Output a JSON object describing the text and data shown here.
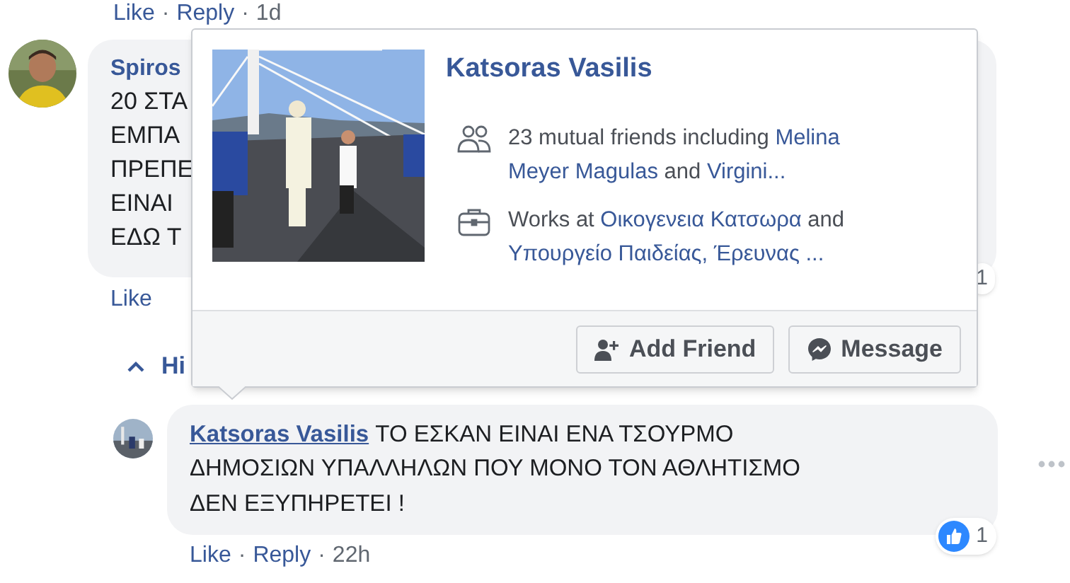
{
  "top_actions": {
    "items": [
      "Like",
      "Reply",
      "1d"
    ],
    "separator": "·"
  },
  "comments": [
    {
      "author": "Spiros",
      "lines": [
        "20 ΣΤΑ",
        "ΕΜΠΑ",
        "ΠΡΕΠΕ",
        "ΕΙΝΑΙ",
        "ΕΔΩ Τ"
      ],
      "actions": [
        "Like"
      ],
      "reaction_count": "1"
    },
    {
      "author": "Katsoras Vasilis",
      "text": "ΤΟ ΕΣΚΑΝ ΕΙΝΑΙ ΕΝΑ ΤΣΟΥΡΜΟ ΔΗΜΟΣΙΩΝ ΥΠΑΛΛΗΛΩΝ ΠΟΥ ΜΟΝΟ ΤΟΝ ΑΘΛΗΤΙΣΜΟ ΔΕΝ ΕΞΥΠΗΡΕΤΕΙ !",
      "actions": [
        "Like",
        "Reply",
        "22h"
      ],
      "reaction_count": "1"
    }
  ],
  "replies_toggle": {
    "label": "Hi"
  },
  "hovercard": {
    "name": "Katsoras Vasilis",
    "rows": [
      {
        "kind": "friends",
        "parts": [
          {
            "text": "23 mutual friends including ",
            "link": false
          },
          {
            "text": "Melina",
            "link": true
          },
          {
            "text": "Meyer Magulas",
            "link": true
          },
          {
            "text": " and ",
            "link": false
          },
          {
            "text": "Virgini...",
            "link": true
          }
        ]
      },
      {
        "kind": "work",
        "parts": [
          {
            "text": "Works at ",
            "link": false
          },
          {
            "text": "Οικογενεια Κατσωρα",
            "link": true
          },
          {
            "text": " and ",
            "link": false
          },
          {
            "text": "Υπουργείο Παιδείας, Έρευνας ...",
            "link": true
          }
        ]
      }
    ],
    "buttons": [
      {
        "kind": "add-friend",
        "label": "Add Friend"
      },
      {
        "kind": "message",
        "label": "Message"
      }
    ]
  }
}
